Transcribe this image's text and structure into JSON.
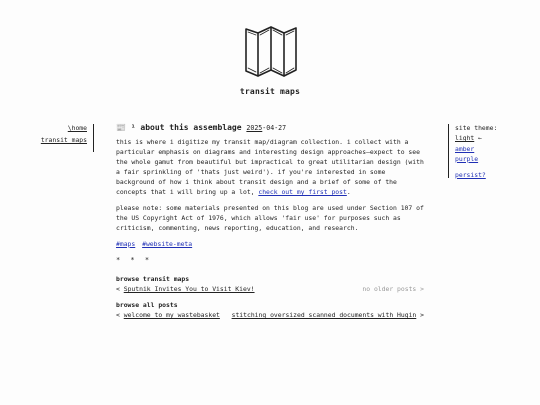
{
  "site": {
    "title": "transit maps"
  },
  "left_nav": {
    "home_label": "\\home",
    "transit_label": "transit maps"
  },
  "post": {
    "title": "📰 ¹ about this assemblage",
    "date_year": "2025",
    "date_rest": "-04-27",
    "para1": "this is where i digitize my transit map/diagram collection. i collect with a particular emphasis on diagrams and interesting design approaches—expect to see the whole gamut from beautiful but impractical to great utilitarian design (with a fair sprinkling of 'thats just weird'). if you're interested in some background of how i think about transit design and a brief of some of the concepts that i will bring up a lot, ",
    "para1_link": "check out my first post",
    "para1_end": ".",
    "para2": "please note: some materials presented on this blog are used under Section 107 of the US Copyright Act of 1976, which allows 'fair use' for purposes such as criticism, commenting, news reporting, education, and research.",
    "tags": [
      "#maps",
      "#website-meta"
    ],
    "divider": "* * *"
  },
  "browse_transit": {
    "heading": "browse transit maps",
    "prev_arrow": "<",
    "prev_label": "Sputnik Invites You to Visit Kiev!",
    "next_label": "no older posts",
    "next_arrow": ">"
  },
  "browse_all": {
    "heading": "browse all posts",
    "prev_arrow": "<",
    "prev_label": "welcome to my wastebasket",
    "next_label": "stitching oversized scanned documents with Hugin",
    "next_arrow": ">"
  },
  "theme": {
    "label": "site theme:",
    "light": "light",
    "light_marker": "←",
    "amber": "amber",
    "purple": "purple",
    "persist": "persist?"
  },
  "colors": {
    "link": "#1f2fb5",
    "text": "#222222",
    "muted": "#999999",
    "background": "#fdfdfd"
  },
  "icons": {
    "logo": "folded-map-icon"
  }
}
